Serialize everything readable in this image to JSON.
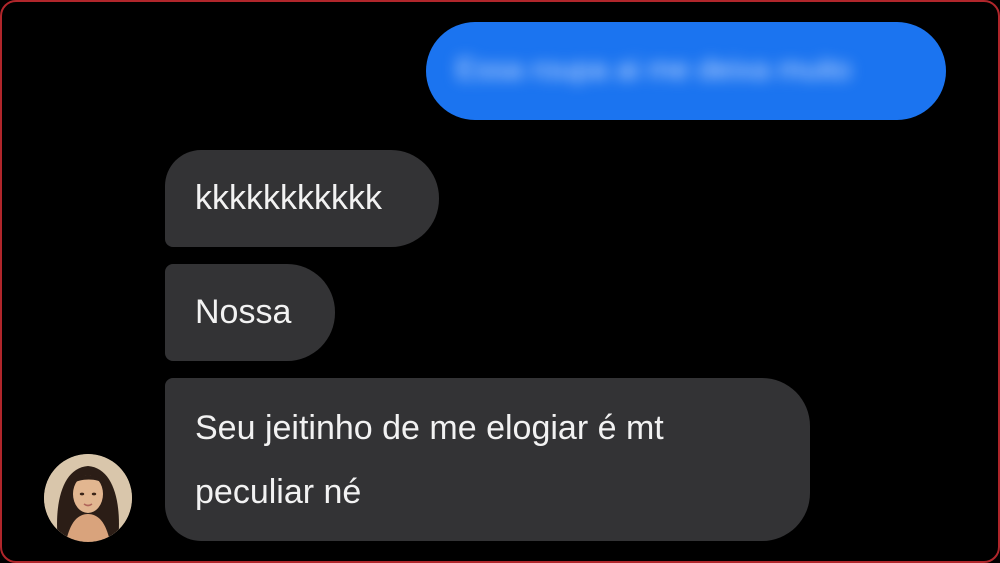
{
  "conversation": {
    "sent_message": {
      "text": "Essa roupa ai me deixa muito",
      "blurred": true,
      "color": "#1b74f0"
    },
    "received_messages": [
      {
        "text": "kkkkkkkkkkk"
      },
      {
        "text": "Nossa"
      },
      {
        "lines": [
          "Seu jeitinho de me elogiar é mt",
          "peculiar né"
        ]
      }
    ],
    "received_bubble_color": "#333335",
    "contact_avatar_icon": "avatar"
  }
}
